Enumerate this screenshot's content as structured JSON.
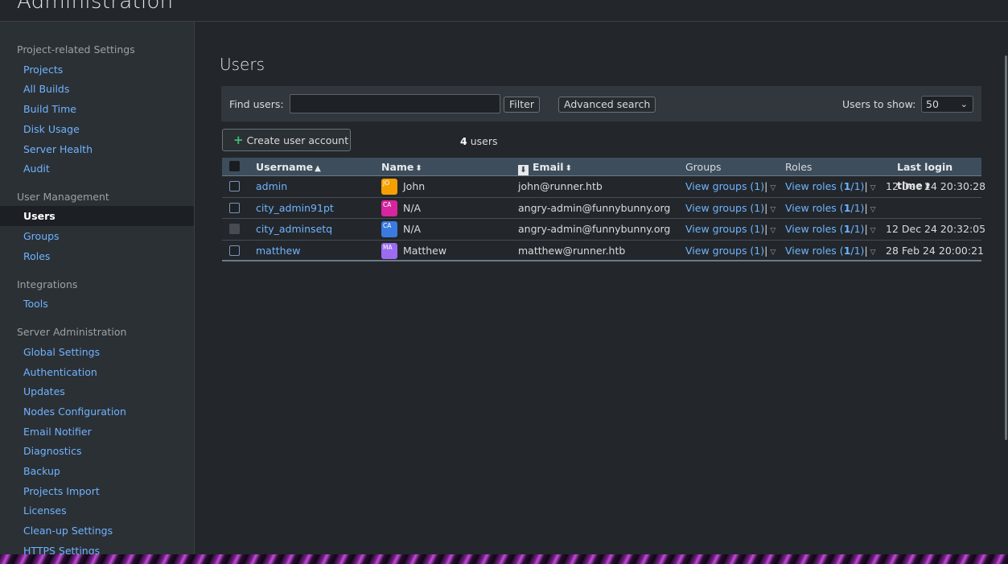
{
  "window": {
    "title": "Administration"
  },
  "sidebar": {
    "sections": [
      {
        "title": "Project-related Settings",
        "items": [
          "Projects",
          "All Builds",
          "Build Time",
          "Disk Usage",
          "Server Health",
          "Audit"
        ]
      },
      {
        "title": "User Management",
        "items": [
          "Users",
          "Groups",
          "Roles"
        ]
      },
      {
        "title": "Integrations",
        "items": [
          "Tools"
        ]
      },
      {
        "title": "Server Administration",
        "items": [
          "Global Settings",
          "Authentication",
          "Updates",
          "Nodes Configuration",
          "Email Notifier",
          "Diagnostics",
          "Backup",
          "Projects Import",
          "Licenses",
          "Clean-up Settings",
          "HTTPS Settings"
        ]
      }
    ],
    "active_item": "Users"
  },
  "main": {
    "title": "Users",
    "filter": {
      "find_label": "Find users:",
      "search_value": "",
      "filter_button": "Filter",
      "advanced_button": "Advanced search",
      "show_label": "Users to show:",
      "show_value": "50"
    },
    "create_button": "Create user account",
    "count": {
      "number": "4",
      "suffix": "users"
    },
    "table": {
      "columns": [
        "Username",
        "Name",
        "Email",
        "Groups",
        "Roles",
        "Last login time"
      ],
      "rows": [
        {
          "username": "admin",
          "avatar": "JO",
          "avatar_color": "#f5a000",
          "name": "John",
          "email": "john@runner.htb",
          "groups": "View groups (1)",
          "roles_prefix": "View roles (",
          "roles_bold": "1",
          "roles_suffix": "/1)",
          "last_login": "12 Dec 24 20:30:28",
          "selected_style": "normal"
        },
        {
          "username": "city_admin91pt",
          "avatar": "CA",
          "avatar_color": "#d6259e",
          "name": "N/A",
          "email": "angry-admin@funnybunny.org",
          "groups": "View groups (1)",
          "roles_prefix": "View roles (",
          "roles_bold": "1",
          "roles_suffix": "/1)",
          "last_login": "",
          "selected_style": "normal"
        },
        {
          "username": "city_adminsetq",
          "avatar": "CA",
          "avatar_color": "#3a7be0",
          "name": "N/A",
          "email": "angry-admin@funnybunny.org",
          "groups": "View groups (1)",
          "roles_prefix": "View roles (",
          "roles_bold": "1",
          "roles_suffix": "/1)",
          "last_login": "12 Dec 24 20:32:05",
          "selected_style": "disabled"
        },
        {
          "username": "matthew",
          "avatar": "MA",
          "avatar_color": "#9b6cf0",
          "name": "Matthew",
          "email": "matthew@runner.htb",
          "groups": "View groups (1)",
          "roles_prefix": "View roles (",
          "roles_bold": "1",
          "roles_suffix": "/1)",
          "last_login": "28 Feb 24 20:00:21",
          "selected_style": "normal"
        }
      ]
    }
  },
  "colors": {
    "accent_link": "#6fb3ff",
    "background": "#23272b",
    "sidebar": "#2b3035",
    "table_header": "#3d4d5c"
  }
}
